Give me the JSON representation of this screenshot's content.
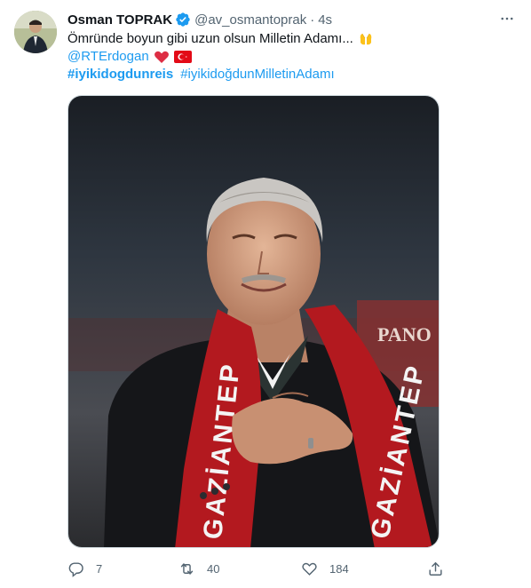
{
  "tweet": {
    "author": {
      "name": "Osman TOPRAK",
      "handle": "@av_osmantoprak",
      "separator": "·",
      "time": "4s"
    },
    "text": {
      "line1": "Ömründe boyun gibi uzun olsun Milletin Adamı...",
      "mention": "@RTErdogan",
      "hashtag1": "#iyikidogdunreis",
      "hashtag2": "#iyikidoğdunMilletinAdamı"
    },
    "media": {
      "scarf_text_left": "GAZİANTEP",
      "scarf_text_right": "GAZİANTEP",
      "banner_text": "PANO"
    },
    "stats": {
      "replies": "7",
      "retweets": "40",
      "likes": "184"
    },
    "icons": {
      "verified": "verified-badge-icon",
      "more": "more-icon",
      "reply": "reply-icon",
      "retweet": "retweet-icon",
      "like": "heart-icon",
      "share": "share-icon"
    },
    "colors": {
      "link": "#1d9bf0",
      "secondary": "#536471",
      "verified": "#1d9bf0"
    }
  }
}
